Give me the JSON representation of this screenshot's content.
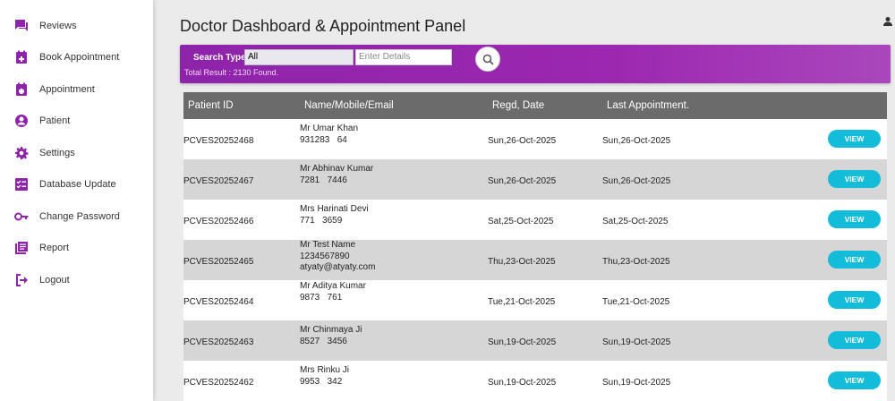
{
  "sidebar": {
    "items": [
      {
        "label": "Reviews",
        "icon": "chat-icon"
      },
      {
        "label": "Book Appointment",
        "icon": "calendar-add-icon"
      },
      {
        "label": "Appointment",
        "icon": "calendar-icon"
      },
      {
        "label": "Patient",
        "icon": "account-circle-icon"
      },
      {
        "label": "Settings",
        "icon": "gear-icon"
      },
      {
        "label": "Database Update",
        "icon": "checklist-icon"
      },
      {
        "label": "Change Password",
        "icon": "key-icon"
      },
      {
        "label": "Report",
        "icon": "report-icon"
      },
      {
        "label": "Logout",
        "icon": "logout-icon"
      }
    ],
    "icon_color": "#8e24aa"
  },
  "header": {
    "title": "Doctor Dashboard & Appointment Panel",
    "user_icon": "person-icon"
  },
  "search": {
    "type_label": "Search Type:",
    "type_value": "All",
    "details_placeholder": "Enter Details",
    "total_result": "Total Result : 2130 Found.",
    "bar_color": "#9c27b0"
  },
  "table": {
    "headers": [
      "Patient ID",
      "Name/Mobile/Email",
      "Regd, Date",
      "Last Appointment."
    ],
    "button_label": "VIEW",
    "button_color": "#13bcd8",
    "rows": [
      {
        "id": "PCVES20252468",
        "name": "Mr Umar Khan",
        "mobile": "931283   64",
        "email": "",
        "regd": "Sun,26-Oct-2025",
        "last": "Sun,26-Oct-2025"
      },
      {
        "id": "PCVES20252467",
        "name": "Mr Abhinav Kumar",
        "mobile": "7281   7446",
        "email": "",
        "regd": "Sun,26-Oct-2025",
        "last": "Sun,26-Oct-2025"
      },
      {
        "id": "PCVES20252466",
        "name": "Mrs Harinati Devi",
        "mobile": "771   3659",
        "email": "",
        "regd": "Sat,25-Oct-2025",
        "last": "Sat,25-Oct-2025"
      },
      {
        "id": "PCVES20252465",
        "name": "Mr Test Name",
        "mobile": "1234567890",
        "email": "atyaty@atyaty.com",
        "regd": "Thu,23-Oct-2025",
        "last": "Thu,23-Oct-2025"
      },
      {
        "id": "PCVES20252464",
        "name": "Mr Aditya Kumar",
        "mobile": "9873   761",
        "email": "",
        "regd": "Tue,21-Oct-2025",
        "last": "Tue,21-Oct-2025"
      },
      {
        "id": "PCVES20252463",
        "name": "Mr Chinmaya Ji",
        "mobile": "8527   3456",
        "email": "",
        "regd": "Sun,19-Oct-2025",
        "last": "Sun,19-Oct-2025"
      },
      {
        "id": "PCVES20252462",
        "name": "Mrs Rinku Ji",
        "mobile": "9953   342",
        "email": "",
        "regd": "Sun,19-Oct-2025",
        "last": "Sun,19-Oct-2025"
      }
    ]
  }
}
